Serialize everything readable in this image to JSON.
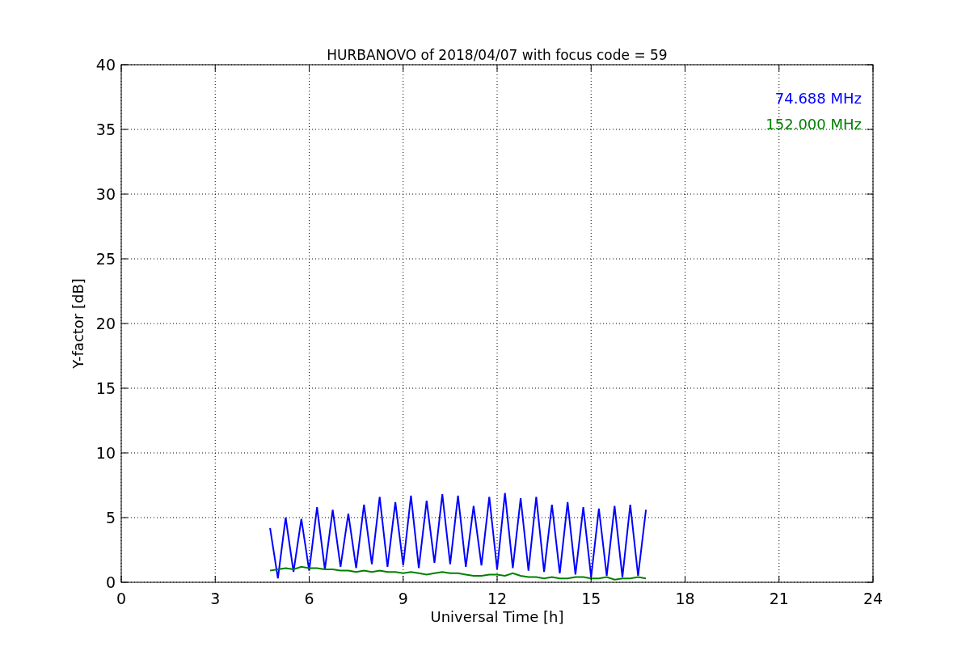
{
  "chart_data": {
    "type": "line",
    "title": "HURBANOVO of 2018/04/07 with focus code = 59",
    "xlabel": "Universal Time [h]",
    "ylabel": "Y-factor [dB]",
    "x": [
      4.75,
      5,
      5.25,
      5.5,
      5.75,
      6,
      6.25,
      6.5,
      6.75,
      7,
      7.25,
      7.5,
      7.75,
      8,
      8.25,
      8.5,
      8.75,
      9,
      9.25,
      9.5,
      9.75,
      10,
      10.25,
      10.5,
      10.75,
      11,
      11.25,
      11.5,
      11.75,
      12,
      12.25,
      12.5,
      12.75,
      13,
      13.25,
      13.5,
      13.75,
      14,
      14.25,
      14.5,
      14.75,
      15,
      15.25,
      15.5,
      15.75,
      16,
      16.25,
      16.5,
      16.75
    ],
    "series": [
      {
        "name": "74.688 MHz",
        "color": "#0000ff",
        "values": [
          4.2,
          0.3,
          5.0,
          0.8,
          4.9,
          0.9,
          5.8,
          1.0,
          5.6,
          1.2,
          5.3,
          1.1,
          6.0,
          1.4,
          6.6,
          1.2,
          6.2,
          1.3,
          6.7,
          1.1,
          6.3,
          1.5,
          6.8,
          1.4,
          6.7,
          1.2,
          5.9,
          1.3,
          6.6,
          1.0,
          6.9,
          1.1,
          6.5,
          0.9,
          6.6,
          0.8,
          6.0,
          0.7,
          6.2,
          0.6,
          5.8,
          0.4,
          5.7,
          0.5,
          5.9,
          0.4,
          6.0,
          0.5,
          5.6
        ]
      },
      {
        "name": "152.000 MHz",
        "color": "#008000",
        "values": [
          0.9,
          1.0,
          1.1,
          1.0,
          1.2,
          1.1,
          1.1,
          1.0,
          1.0,
          0.9,
          0.9,
          0.8,
          0.9,
          0.8,
          0.9,
          0.8,
          0.8,
          0.7,
          0.8,
          0.7,
          0.6,
          0.7,
          0.8,
          0.7,
          0.7,
          0.6,
          0.5,
          0.5,
          0.6,
          0.6,
          0.5,
          0.7,
          0.5,
          0.4,
          0.4,
          0.3,
          0.4,
          0.3,
          0.3,
          0.4,
          0.4,
          0.3,
          0.3,
          0.4,
          0.2,
          0.3,
          0.3,
          0.4,
          0.3
        ]
      }
    ],
    "grid": true,
    "xlim": [
      0,
      24
    ],
    "ylim": [
      0,
      40
    ],
    "xticks": [
      0,
      3,
      6,
      9,
      12,
      15,
      18,
      21,
      24
    ],
    "yticks": [
      0,
      5,
      10,
      15,
      20,
      25,
      30,
      35,
      40
    ]
  }
}
